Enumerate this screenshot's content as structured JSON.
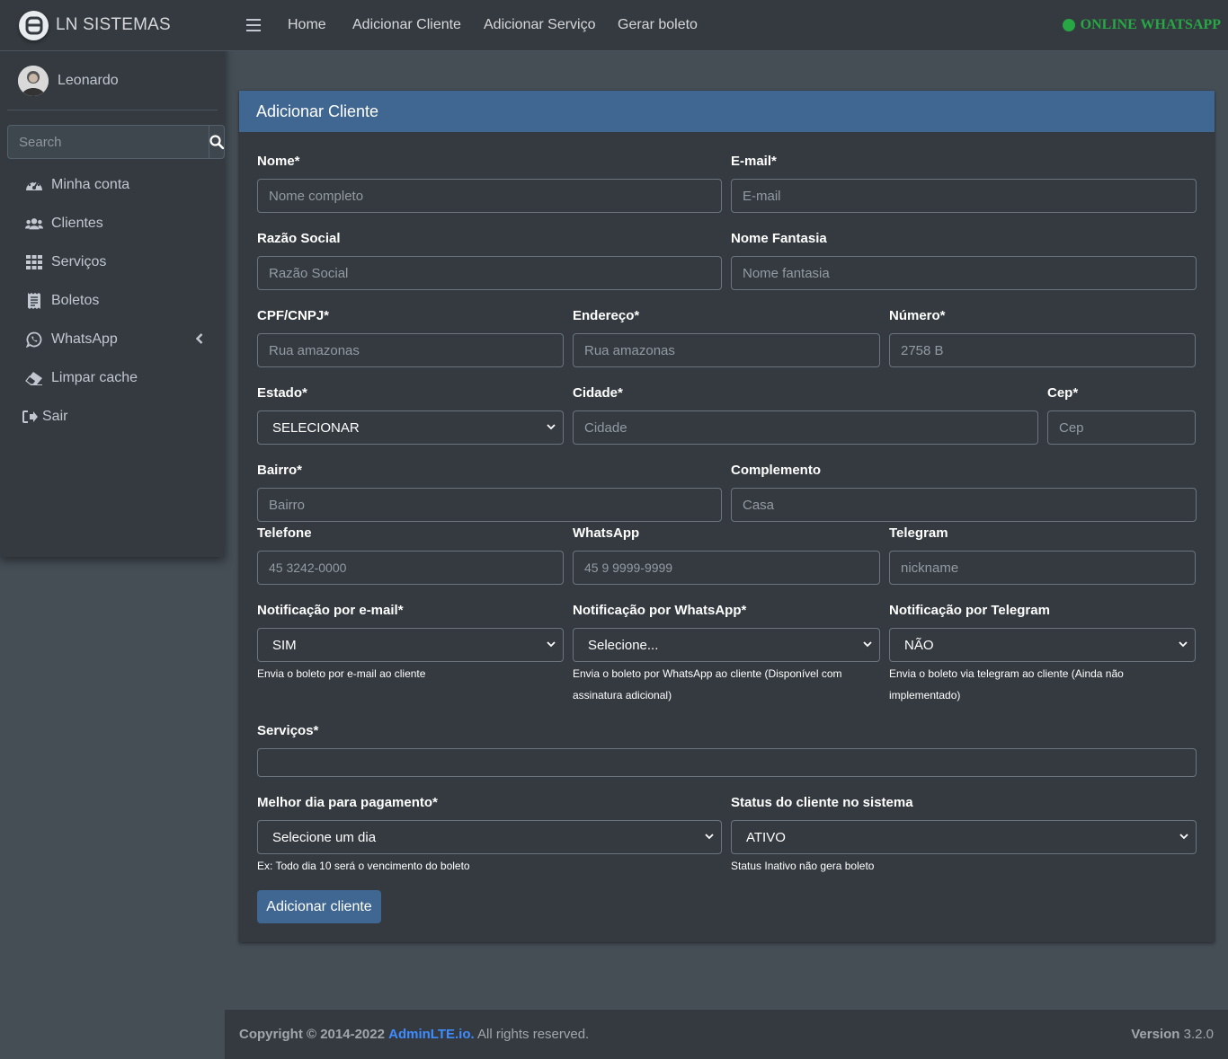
{
  "brand": {
    "name": "LN SISTEMAS"
  },
  "user": {
    "name": "Leonardo"
  },
  "sidebar": {
    "search_placeholder": "Search",
    "items": [
      {
        "label": "Minha conta",
        "icon": "tachometer-icon"
      },
      {
        "label": "Clientes",
        "icon": "users-icon"
      },
      {
        "label": "Serviços",
        "icon": "grid-icon"
      },
      {
        "label": "Boletos",
        "icon": "receipt-icon"
      },
      {
        "label": "WhatsApp",
        "icon": "whatsapp-icon"
      },
      {
        "label": "Limpar cache",
        "icon": "eraser-icon"
      },
      {
        "label": "Sair",
        "icon": "sign-out-icon"
      }
    ]
  },
  "topnav": {
    "links": [
      "Home",
      "Adicionar Cliente",
      "Adicionar Serviço",
      "Gerar boleto"
    ],
    "status": "ONLINE WHATSAPP"
  },
  "form": {
    "title": "Adicionar Cliente",
    "fields": {
      "nome": {
        "label": "Nome*",
        "placeholder": "Nome completo"
      },
      "email": {
        "label": "E-mail*",
        "placeholder": "E-mail"
      },
      "razao": {
        "label": "Razão Social",
        "placeholder": "Razão Social"
      },
      "fantasia": {
        "label": "Nome Fantasia",
        "placeholder": "Nome fantasia"
      },
      "cpf": {
        "label": "CPF/CNPJ*",
        "placeholder": "Rua amazonas"
      },
      "endereco": {
        "label": "Endereço*",
        "placeholder": "Rua amazonas"
      },
      "numero": {
        "label": "Número*",
        "placeholder": "2758 B"
      },
      "estado": {
        "label": "Estado*",
        "value": "SELECIONAR"
      },
      "cidade": {
        "label": "Cidade*",
        "placeholder": "Cidade"
      },
      "cep": {
        "label": "Cep*",
        "placeholder": "Cep"
      },
      "bairro": {
        "label": "Bairro*",
        "placeholder": "Bairro"
      },
      "complemento": {
        "label": "Complemento",
        "placeholder": "Casa"
      },
      "telefone": {
        "label": "Telefone",
        "placeholder": "45 3242-0000"
      },
      "whatsapp": {
        "label": "WhatsApp",
        "placeholder": "45 9 9999-9999"
      },
      "telegram": {
        "label": "Telegram",
        "placeholder": "nickname"
      },
      "notif_email": {
        "label": "Notificação por e-mail*",
        "value": "SIM",
        "help": "Envia o boleto por e-mail ao cliente"
      },
      "notif_whatsapp": {
        "label": "Notificação por WhatsApp*",
        "value": "Selecione...",
        "help1": "Envia o boleto por WhatsApp ao cliente (Disponível com",
        "help2": "assinatura adicional)"
      },
      "notif_telegram": {
        "label": "Notificação por Telegram",
        "value": "NÃO",
        "help1": "Envia o boleto via telegram ao cliente (Ainda não",
        "help2": "implementado)"
      },
      "servicos": {
        "label": "Serviços*"
      },
      "dia": {
        "label": "Melhor dia para pagamento*",
        "value": "Selecione um dia",
        "help": "Ex: Todo dia 10 será o vencimento do boleto"
      },
      "status": {
        "label": "Status do cliente no sistema",
        "value": "ATIVO",
        "help": "Status Inativo não gera boleto"
      }
    },
    "submit_label": "Adicionar cliente"
  },
  "footer": {
    "copyright": "Copyright © 2014-2022",
    "link": "AdminLTE.io.",
    "rights": "All rights reserved.",
    "version_label": "Version",
    "version": "3.2.0"
  },
  "colors": {
    "accent": "#3f6791",
    "online": "#28a745",
    "sidebar": "#343a40",
    "content": "#454d55"
  }
}
